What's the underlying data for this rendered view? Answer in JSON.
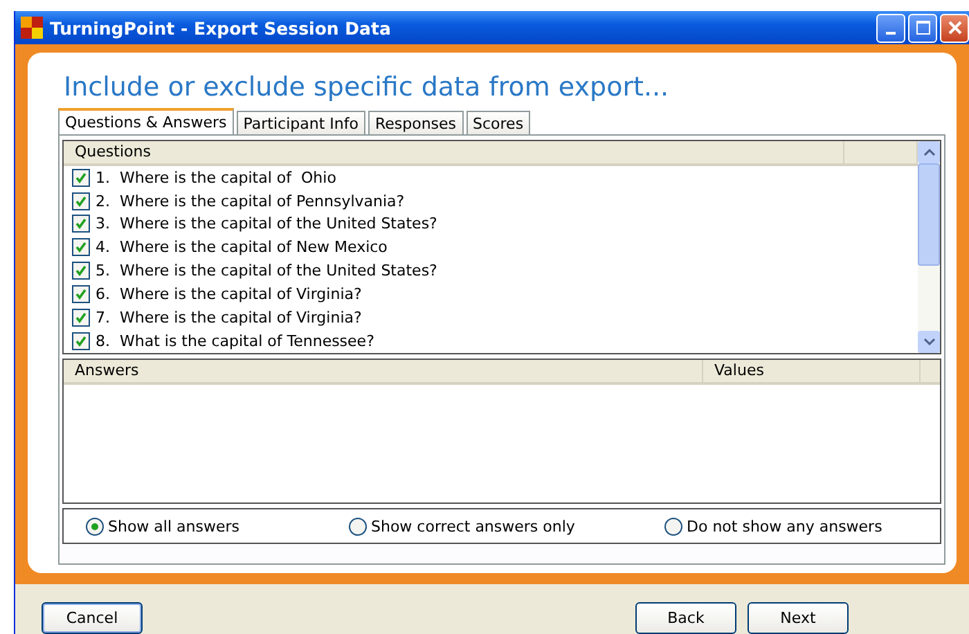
{
  "window": {
    "title": "TurningPoint - Export Session Data"
  },
  "heading": "Include or exclude specific data from export...",
  "tabs": [
    {
      "label": "Questions & Answers",
      "selected": true
    },
    {
      "label": "Participant Info",
      "selected": false
    },
    {
      "label": "Responses",
      "selected": false
    },
    {
      "label": "Scores",
      "selected": false
    }
  ],
  "questions": {
    "column": "Questions",
    "rows": [
      {
        "number": "1.",
        "text": "Where is the capital of  Ohio",
        "checked": true
      },
      {
        "number": "2.",
        "text": "Where is the capital of Pennsylvania?",
        "checked": true
      },
      {
        "number": "3.",
        "text": "Where is the capital of the United States?",
        "checked": true
      },
      {
        "number": "4.",
        "text": "Where is the capital of New Mexico",
        "checked": true
      },
      {
        "number": "5.",
        "text": "Where is the capital of the United States?",
        "checked": true
      },
      {
        "number": "6.",
        "text": "Where is the capital of Virginia?",
        "checked": true
      },
      {
        "number": "7.",
        "text": "Where is the capital of Virginia?",
        "checked": true
      },
      {
        "number": "8.",
        "text": "What is the capital of Tennessee?",
        "checked": true
      }
    ]
  },
  "answers": {
    "columns": [
      "Answers",
      "Values"
    ]
  },
  "answer_filter": [
    {
      "label": "Show all answers",
      "selected": true
    },
    {
      "label": "Show correct answers only",
      "selected": false
    },
    {
      "label": "Do not show any answers",
      "selected": false
    }
  ],
  "buttons": {
    "left": [
      "Cancel"
    ],
    "right": [
      "Back",
      "Next"
    ]
  }
}
